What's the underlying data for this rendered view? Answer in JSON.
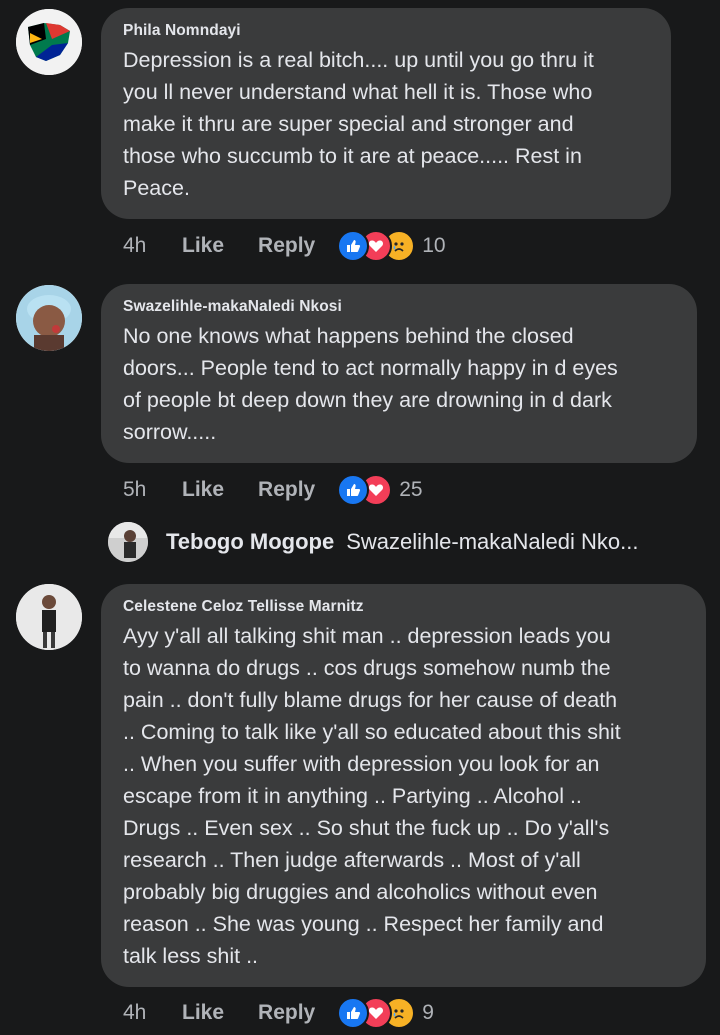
{
  "comments": [
    {
      "author": "Phila Nomndayi",
      "text": "Depression is a real bitch.... up until you go thru it\nyou ll never understand what hell it is. Those who\nmake it thru are super special and stronger and\nthose who succumb to it are at peace..... Rest in\nPeace.",
      "time": "4h",
      "like_label": "Like",
      "reply_label": "Reply",
      "reactions": [
        "like",
        "love",
        "sad"
      ],
      "reaction_count": "10"
    },
    {
      "author": "Swazelihle-makaNaledi Nkosi",
      "text": "No one knows what happens behind the closed\ndoors... People tend to act normally happy in d eyes\nof people bt deep down they are drowning in d dark\nsorrow.....",
      "time": "5h",
      "like_label": "Like",
      "reply_label": "Reply",
      "reactions": [
        "like",
        "love"
      ],
      "reaction_count": "25"
    },
    {
      "author": "Celestene Celoz Tellisse Marnitz",
      "text": "Ayy y'all all talking shit man .. depression leads you\nto wanna do drugs .. cos drugs somehow numb the\npain .. don't fully blame drugs for her cause of death\n.. Coming to talk like y'all so educated about this shit\n.. When you suffer with depression you look for an\nescape from it in anything .. Partying .. Alcohol ..\nDrugs .. Even sex .. So shut the fuck up .. Do y'all's\nresearch .. Then judge afterwards .. Most of y'all\nprobably big druggies and alcoholics without even\nreason .. She was young .. Respect her family and\ntalk less shit ..",
      "time": "4h",
      "like_label": "Like",
      "reply_label": "Reply",
      "reactions": [
        "like",
        "love",
        "sad"
      ],
      "reaction_count": "9"
    }
  ],
  "reply_preview": {
    "author": "Tebogo Mogope",
    "text": "Swazelihle-makaNaledi Nko..."
  },
  "colors": {
    "background": "#18191a",
    "bubble": "#3a3b3c",
    "text": "#e4e6eb",
    "meta": "#b0b3b8",
    "like_reaction": "#1877f2",
    "love_reaction": "#f33e58",
    "sad_reaction": "#f7b125"
  },
  "icons": [
    "thumbs-up-icon",
    "heart-icon",
    "sad-face-icon"
  ]
}
